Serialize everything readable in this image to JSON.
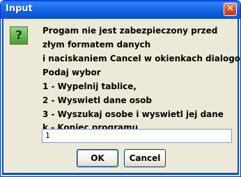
{
  "window": {
    "title": "Input",
    "close_glyph": "✕"
  },
  "icon": {
    "name": "question-icon",
    "glyph": "?"
  },
  "message": {
    "lines": [
      "Progam nie jest zabezpieczony przed",
      "złym formatem danych",
      " i naciskaniem Cancel w okienkach dialogowych",
      "Podaj wybor",
      "1 - Wypelnij tablice,",
      "2 - Wyswietl dane osob",
      "3 - Wyszukaj osobe i wyswietl jej dane",
      "k - Koniec programu"
    ]
  },
  "input": {
    "value": "1"
  },
  "buttons": {
    "ok_label": "OK",
    "cancel_label": "Cancel"
  }
}
